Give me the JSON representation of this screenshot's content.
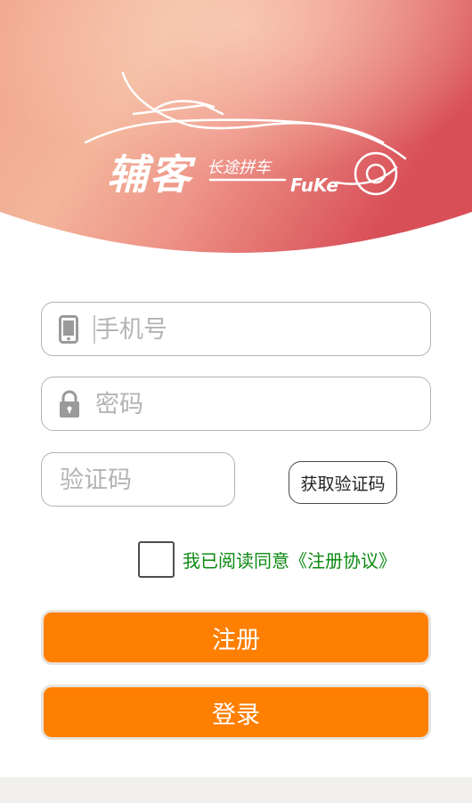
{
  "brand": {
    "name_cn": "辅客",
    "tagline": "长途拼车",
    "name_en": "FuKe"
  },
  "form": {
    "phone": {
      "placeholder": "手机号",
      "icon": "phone-icon"
    },
    "password": {
      "placeholder": "密码",
      "icon": "lock-icon"
    },
    "code": {
      "placeholder": "验证码"
    },
    "get_code_label": "获取验证码",
    "agreement_text": "我已阅读同意《注册协议》",
    "agreement_checked": false
  },
  "actions": {
    "register_label": "注册",
    "login_label": "登录"
  },
  "colors": {
    "primary": "#ff7f00",
    "agreement": "#0c8a12",
    "hero_start": "#f2a98e",
    "hero_end": "#d9535b"
  }
}
